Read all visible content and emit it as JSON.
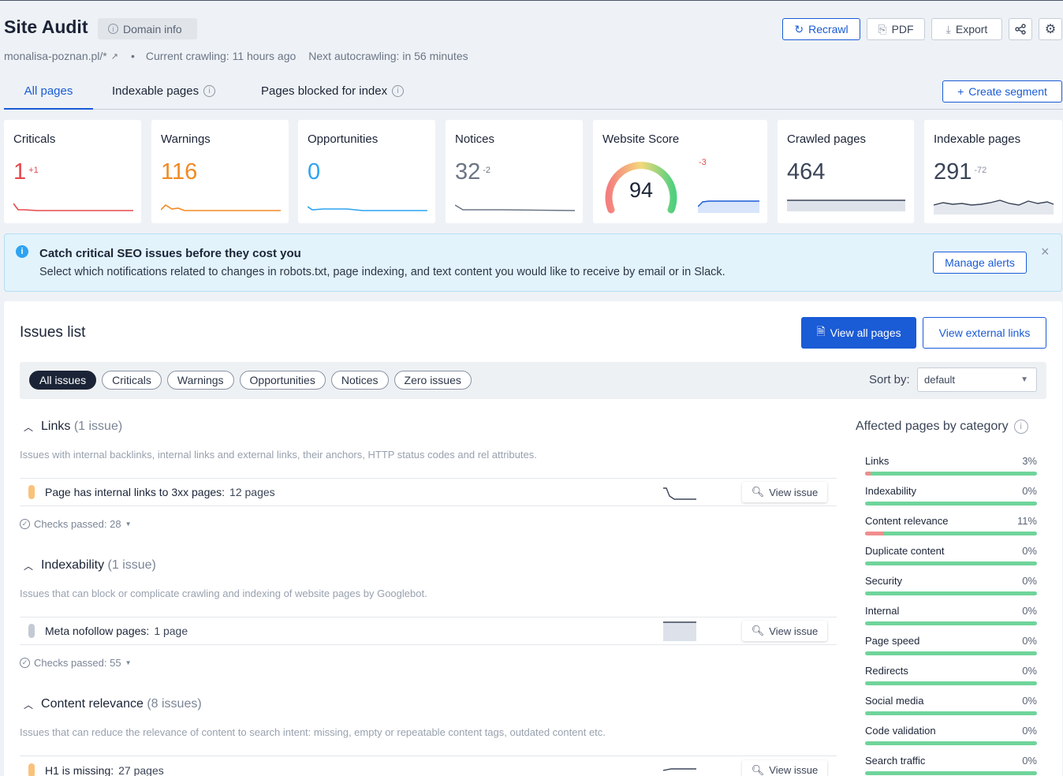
{
  "header": {
    "title": "Site Audit",
    "domain_info_label": "Domain info",
    "domain": "monalisa-poznan.pl/*",
    "current_crawling": "Current crawling: 11 hours ago",
    "next_autocrawling": "Next autocrawling: in 56 minutes",
    "recrawl_label": "Recrawl",
    "pdf_label": "PDF",
    "export_label": "Export"
  },
  "tabs": {
    "all_pages": "All pages",
    "indexable_pages": "Indexable pages",
    "blocked_pages": "Pages blocked for index",
    "create_segment": "Create segment"
  },
  "metrics": {
    "criticals": {
      "title": "Criticals",
      "value": "1",
      "delta": "+1",
      "color": "#e5484d"
    },
    "warnings": {
      "title": "Warnings",
      "value": "116",
      "delta": "",
      "color": "#f08a24"
    },
    "opportunities": {
      "title": "Opportunities",
      "value": "0",
      "delta": "",
      "color": "#2ea3f2"
    },
    "notices": {
      "title": "Notices",
      "value": "32",
      "delta": "-2",
      "color": "#6b7585"
    },
    "website_score": {
      "title": "Website Score",
      "value": "94",
      "delta": "-3",
      "score_fraction": 0.94
    },
    "crawled_pages": {
      "title": "Crawled pages",
      "value": "464"
    },
    "indexable_pages": {
      "title": "Indexable pages",
      "value": "291",
      "delta": "-72"
    }
  },
  "alert": {
    "title": "Catch critical SEO issues before they cost you",
    "text": "Select which notifications related to changes in robots.txt, page indexing, and text content you would like to receive by email or in Slack.",
    "button": "Manage alerts"
  },
  "issues": {
    "title": "Issues list",
    "view_all_pages": "View all pages",
    "view_external_links": "View external links",
    "filters": [
      "All issues",
      "Criticals",
      "Warnings",
      "Opportunities",
      "Notices",
      "Zero issues"
    ],
    "sort_by_label": "Sort by:",
    "sort_value": "default",
    "view_issue_label": "View issue",
    "sections": [
      {
        "name": "Links",
        "count": "(1 issue)",
        "description": "Issues with internal backlinks, internal links and external links, their anchors, HTTP status codes and rel attributes.",
        "row_label": "Page has internal links to 3xx pages:",
        "row_count": "12 pages",
        "checks": "Checks passed: 28"
      },
      {
        "name": "Indexability",
        "count": "(1 issue)",
        "description": "Issues that can block or complicate crawling and indexing of website pages by Googlebot.",
        "row_label": "Meta nofollow pages:",
        "row_count": "1 page",
        "checks": "Checks passed: 55"
      },
      {
        "name": "Content relevance",
        "count": "(8 issues)",
        "description": "Issues that can reduce the relevance of content to search intent: missing, empty or repeatable content tags, outdated content etc.",
        "row_label": "H1 is missing:",
        "row_count": "27 pages"
      }
    ]
  },
  "categories": {
    "title": "Affected pages by category",
    "items": [
      {
        "label": "Links",
        "value": "3%",
        "fraction": 0.03
      },
      {
        "label": "Indexability",
        "value": "0%",
        "fraction": 0
      },
      {
        "label": "Content relevance",
        "value": "11%",
        "fraction": 0.11
      },
      {
        "label": "Duplicate content",
        "value": "0%",
        "fraction": 0
      },
      {
        "label": "Security",
        "value": "0%",
        "fraction": 0
      },
      {
        "label": "Internal",
        "value": "0%",
        "fraction": 0
      },
      {
        "label": "Page speed",
        "value": "0%",
        "fraction": 0
      },
      {
        "label": "Redirects",
        "value": "0%",
        "fraction": 0
      },
      {
        "label": "Social media",
        "value": "0%",
        "fraction": 0
      },
      {
        "label": "Code validation",
        "value": "0%",
        "fraction": 0
      },
      {
        "label": "Search traffic",
        "value": "0%",
        "fraction": 0
      }
    ]
  }
}
